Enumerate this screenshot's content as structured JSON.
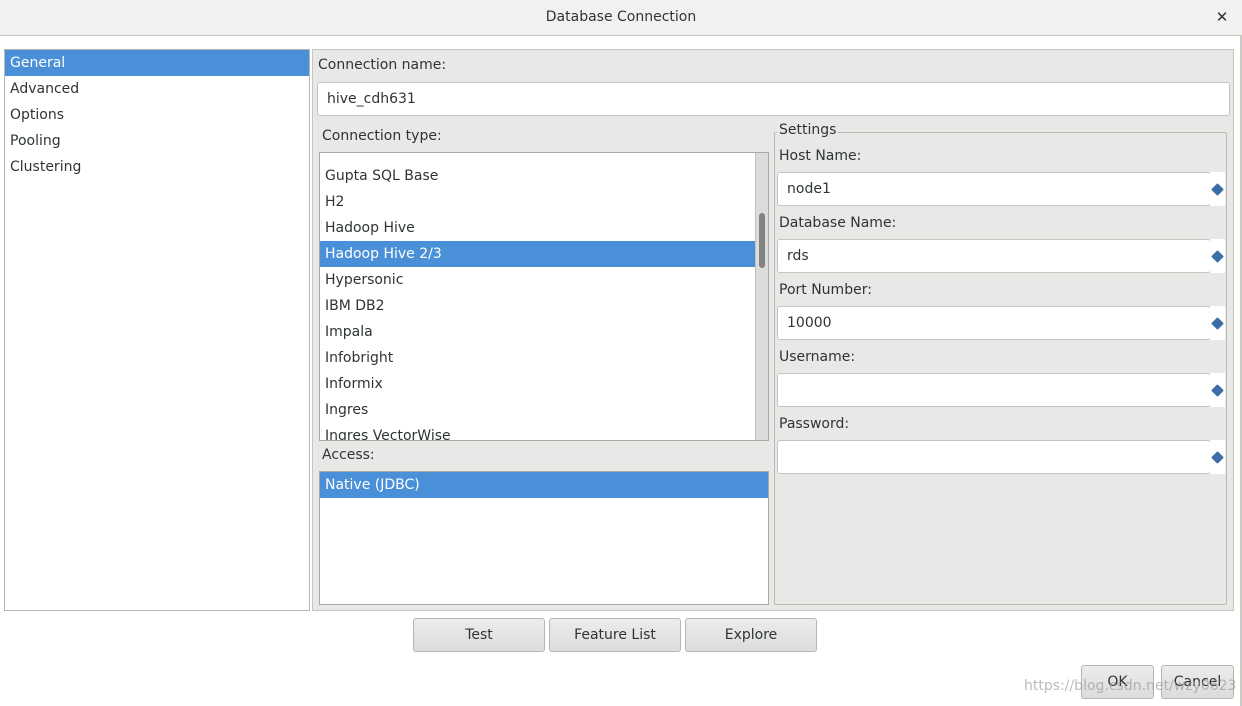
{
  "window": {
    "title": "Database Connection",
    "close_glyph": "✕"
  },
  "nav": {
    "items": [
      {
        "label": "General",
        "selected": true
      },
      {
        "label": "Advanced",
        "selected": false
      },
      {
        "label": "Options",
        "selected": false
      },
      {
        "label": "Pooling",
        "selected": false
      },
      {
        "label": "Clustering",
        "selected": false
      }
    ]
  },
  "general": {
    "connection_name_label": "Connection name:",
    "connection_name_value": "hive_cdh631",
    "connection_type_label": "Connection type:",
    "connection_types": [
      "Gupta SQL Base",
      "H2",
      "Hadoop Hive",
      "Hadoop Hive 2/3",
      "Hypersonic",
      "IBM DB2",
      "Impala",
      "Infobright",
      "Informix",
      "Ingres",
      "Ingres VectorWise"
    ],
    "selected_connection_type": "Hadoop Hive 2/3",
    "access_label": "Access:",
    "access_options": [
      "Native (JDBC)"
    ],
    "selected_access": "Native (JDBC)"
  },
  "settings": {
    "legend": "Settings",
    "host_label": "Host Name:",
    "host_value": "node1",
    "database_label": "Database Name:",
    "database_value": "rds",
    "port_label": "Port Number:",
    "port_value": "10000",
    "username_label": "Username:",
    "username_value": "",
    "password_label": "Password:",
    "password_value": ""
  },
  "actions": {
    "test": "Test",
    "feature_list": "Feature List",
    "explore": "Explore",
    "ok": "OK",
    "cancel": "Cancel"
  },
  "watermark": "https://blog.csdn.net/wzy0623",
  "colors": {
    "selection": "#4a90d9",
    "variable_icon": "#3a6ea5"
  }
}
